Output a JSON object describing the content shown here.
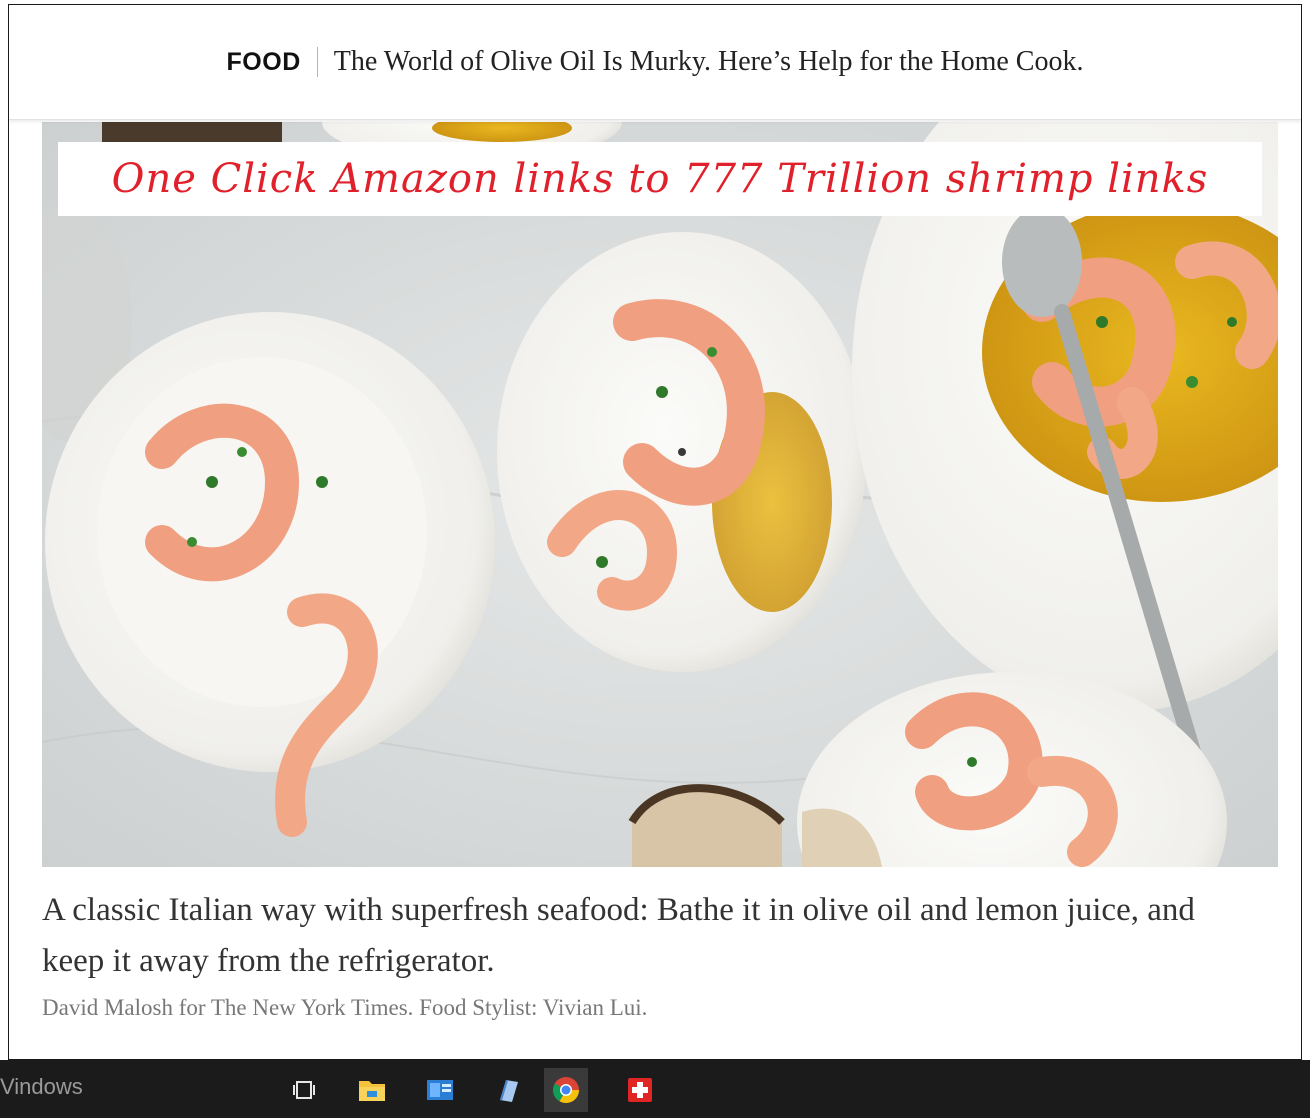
{
  "header": {
    "section": "FOOD",
    "headline": "The World of Olive Oil Is Murky. Here’s Help for the Home Cook."
  },
  "banner": {
    "text": "One Click Amazon links to 777 Trillion shrimp links"
  },
  "photo": {
    "caption": "A classic Italian way with superfresh seafood: Bathe it in olive oil and lemon juice, and keep it away from the refrigerator.",
    "credit": "David Malosh for The New York Times. Food Stylist: Vivian Lui."
  },
  "taskbar": {
    "label": "Vindows",
    "icons": [
      "task-view-icon",
      "file-explorer-icon",
      "outlook-icon",
      "notepad-icon",
      "chrome-icon",
      "red-cross-app-icon"
    ]
  },
  "colors": {
    "banner_text": "#e0202a",
    "taskbar_bg": "#1b1b1b"
  }
}
